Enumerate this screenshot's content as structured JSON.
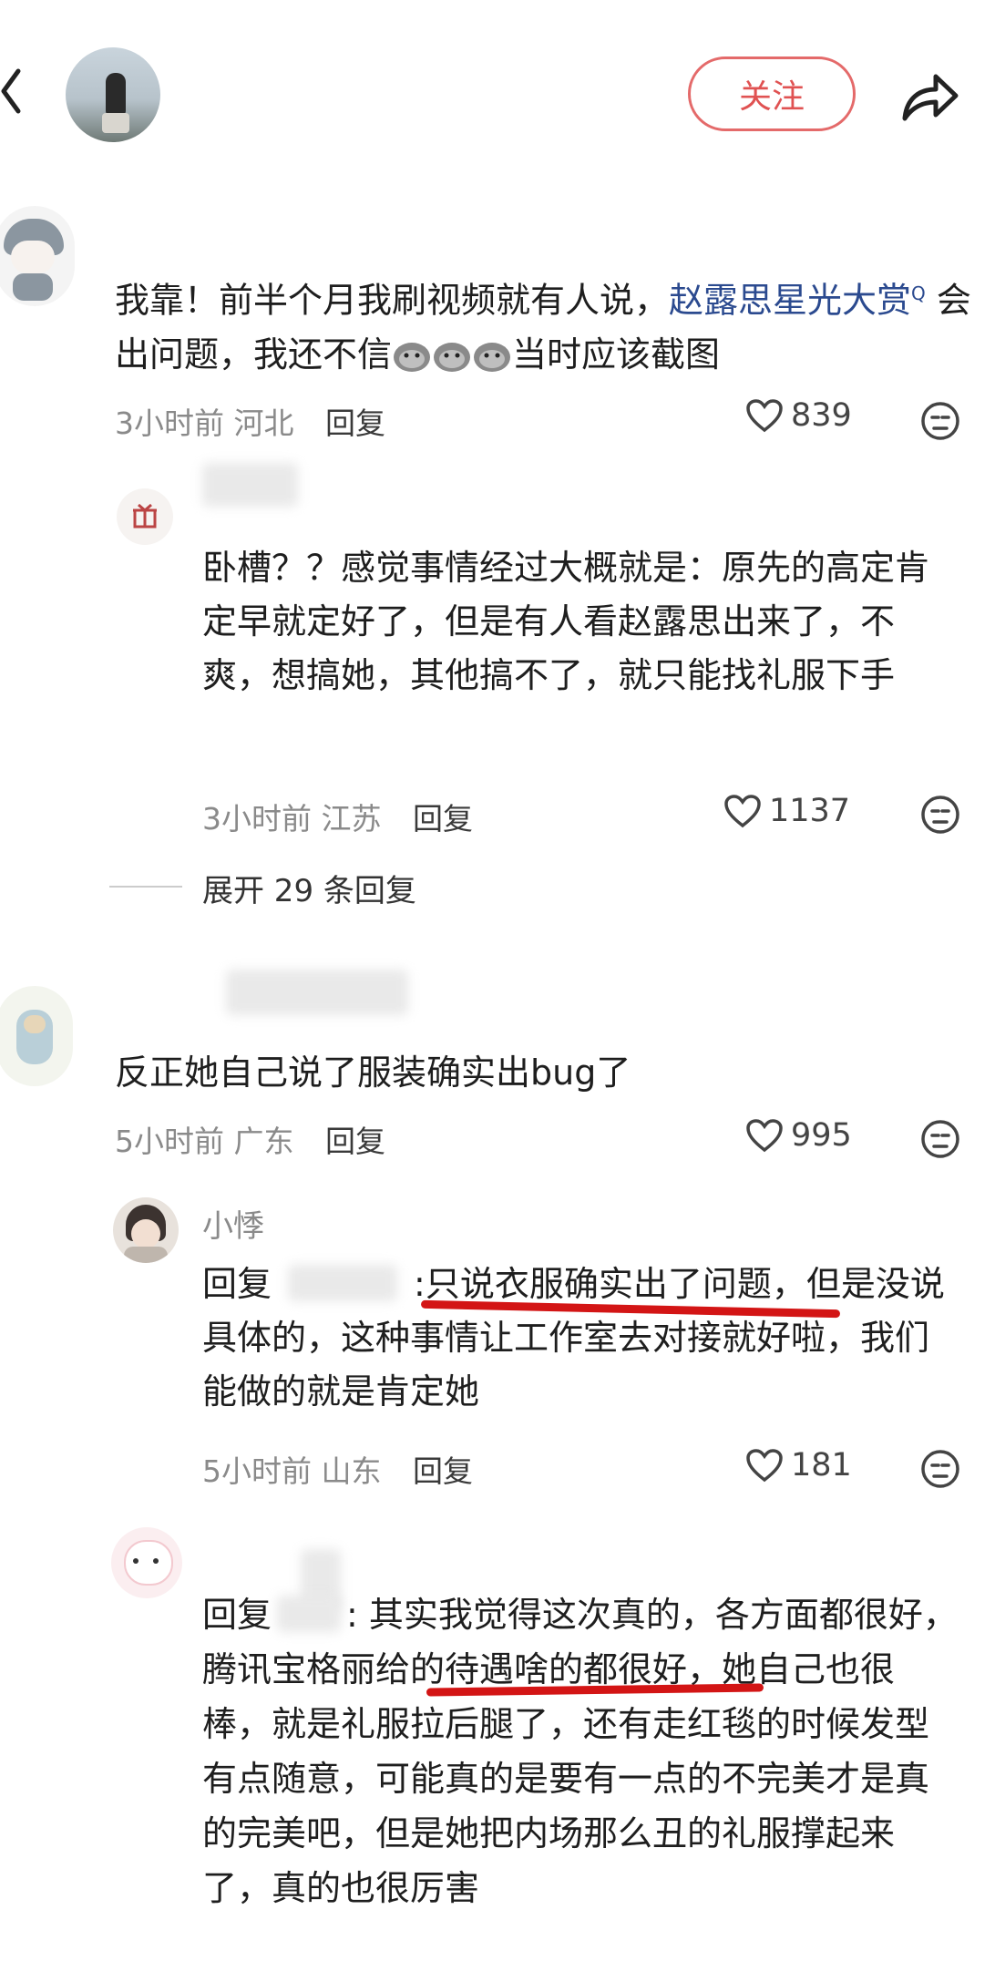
{
  "header": {
    "follow_label": "关注"
  },
  "comments": [
    {
      "text_before_link": "我靠！前半个月我刷视频就有人说，",
      "link_text": "赵露思星光大赏",
      "search_mark": "Q",
      "text_after_link": "会出问题，我还不信",
      "text_end": "当时应该截图",
      "time": "3小时前",
      "location": "河北",
      "reply_label": "回复",
      "likes": "839"
    },
    {
      "text": "卧槽？？感觉事情经过大概就是：原先的高定肯定早就定好了，但是有人看赵露思出来了，不爽，想搞她，其他搞不了，就只能找礼服下手",
      "time": "3小时前",
      "location": "江苏",
      "reply_label": "回复",
      "likes": "1137"
    },
    {
      "text": "反正她自己说了服装确实出bug了",
      "time": "5小时前",
      "location": "广东",
      "reply_label": "回复",
      "likes": "995"
    },
    {
      "username": "小悸",
      "reply_prefix": "回复",
      "highlight": "只说衣服确实出了问题",
      "text_after": "，但是没说具体的，这种事情让工作室去对接就好啦，我们能做的就是肯定她",
      "time": "5小时前",
      "location": "山东",
      "reply_label": "回复",
      "likes": "181"
    },
    {
      "reply_prefix": "回复",
      "text_before": ": 其实我觉得这次真的，各方面都很好，腾讯宝格丽给的待遇啥的都很好，她自己也很棒，",
      "highlight": "就是礼服拉后腿了",
      "text_after": "，还有走红毯的时候发型有点随意，可能真的是要有一点的不完美才是真的完美吧，但是她把内场那么丑的礼服撑起来了，真的也很厉害"
    }
  ],
  "expand_label": "展开 29 条回复"
}
